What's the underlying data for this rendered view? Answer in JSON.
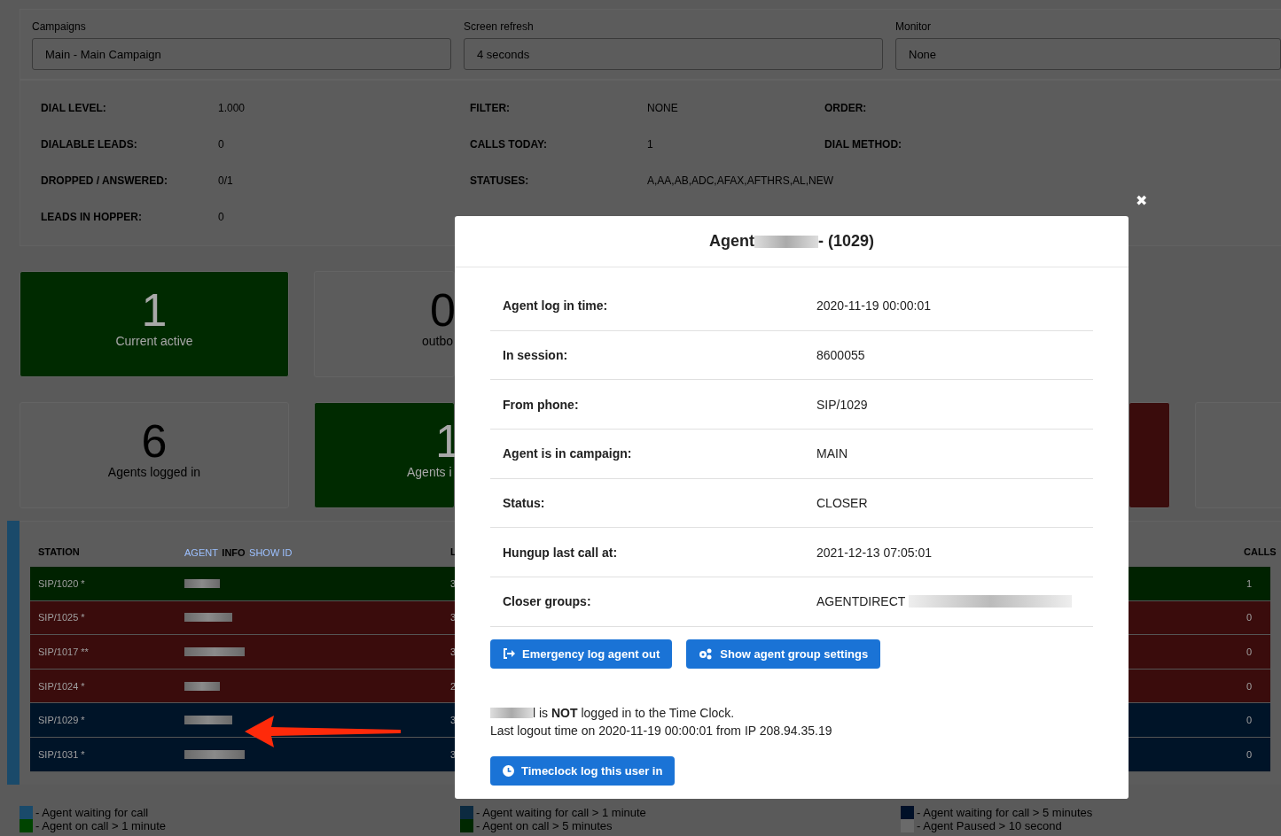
{
  "filters": [
    {
      "label": "Campaigns",
      "value": "Main - Main Campaign"
    },
    {
      "label": "Screen refresh",
      "value": "4 seconds"
    },
    {
      "label": "Monitor",
      "value": "None"
    }
  ],
  "stats": [
    [
      {
        "label": "DIAL LEVEL:",
        "value": "1.000"
      },
      {
        "label": "FILTER:",
        "value": "NONE"
      },
      {
        "label": "ORDER:"
      }
    ],
    [
      {
        "label": "DIALABLE LEADS:",
        "value": "0"
      },
      {
        "label": "CALLS TODAY:",
        "value": "1"
      },
      {
        "label": "DIAL METHOD:"
      }
    ],
    [
      {
        "label": "DROPPED / ANSWERED:",
        "value": "0/1"
      },
      {
        "label": "STATUSES:",
        "value": "A,AA,AB,ADC,AFAX,AFTHRS,AL,NEW"
      }
    ],
    [
      {
        "label": "LEADS IN HOPPER:",
        "value": "0"
      }
    ]
  ],
  "cards_top": [
    {
      "number": "1",
      "caption": "Current active",
      "color": "#002a00"
    },
    {
      "number": "0",
      "caption": "outbo",
      "color": "#5c5c5c"
    }
  ],
  "cards_bottom": [
    {
      "number": "6",
      "caption": "Agents logged in",
      "color": "#5c5c5c"
    },
    {
      "number": "1",
      "caption": "Agents i",
      "color": "#002a00"
    },
    {
      "color": "#3a0c0c"
    },
    {
      "color": "#5c5c5c"
    }
  ],
  "table": {
    "columns": [
      {
        "label": "STATION"
      },
      {
        "parts": [
          {
            "text": "AGENT",
            "link": true
          },
          {
            "text": "INFO",
            "link": false
          },
          {
            "text": "SHOW ID",
            "link": true
          }
        ]
      },
      {
        "label": "L"
      },
      {
        "label": "CALLS"
      }
    ],
    "rows": [
      {
        "station": "SIP/1020 *",
        "column_3": "3",
        "calls": "1",
        "color": "#002200"
      },
      {
        "station": "SIP/1025 *",
        "column_3": "3",
        "calls": "0",
        "color": "#3a0c0c"
      },
      {
        "station": "SIP/1017 **",
        "column_3": "3",
        "calls": "0",
        "color": "#3a0c0c"
      },
      {
        "station": "SIP/1024 *",
        "column_3": "2",
        "calls": "0",
        "color": "#3a0c0c"
      },
      {
        "station": "SIP/1029 *",
        "column_3": "3",
        "calls": "0",
        "color": "#001428"
      },
      {
        "station": "SIP/1031 *",
        "column_3": "3",
        "calls": "0",
        "color": "#001428"
      }
    ]
  },
  "legend": [
    [
      {
        "text": "- Agent waiting for call",
        "color": "#1a4a6a"
      },
      {
        "text": "- Agent on call > 1 minute",
        "color": "#004400"
      }
    ],
    [
      {
        "text": "- Agent waiting for call > 1 minute",
        "color": "#0c2a40"
      },
      {
        "text": "- Agent on call > 5 minutes",
        "color": "#002800"
      }
    ],
    [
      {
        "text": "- Agent waiting for call > 5 minutes",
        "color": "#001028"
      },
      {
        "text": "- Agent Paused > 10 second",
        "color": "#6a6a6a"
      }
    ]
  ],
  "modal": {
    "title_start": "Agent",
    "title_end": "- (1029)",
    "rows": [
      {
        "label": "Agent log in time:",
        "value": "2020-11-19 00:00:01"
      },
      {
        "label": "In session:",
        "value": "8600055"
      },
      {
        "label": "From phone:",
        "value": "SIP/1029"
      },
      {
        "label": "Agent is in campaign:",
        "value": "MAIN"
      },
      {
        "label": "Status:",
        "value": "CLOSER"
      },
      {
        "label": "Hungup last call at:",
        "value": "2021-12-13 07:05:01"
      },
      {
        "label": "Closer groups:",
        "value": "AGENTDIRECT",
        "redacted": true
      }
    ],
    "buttons": [
      "Emergency log agent out",
      "Show agent group settings"
    ],
    "notice": "l is **NOT** logged in to the Time Clock.",
    "last_logout": "Last logout time on 2020-11-19 00:00:01 from IP 208.94.35.19",
    "timeclock_button": "Timeclock log this user in",
    "close": "✖"
  }
}
